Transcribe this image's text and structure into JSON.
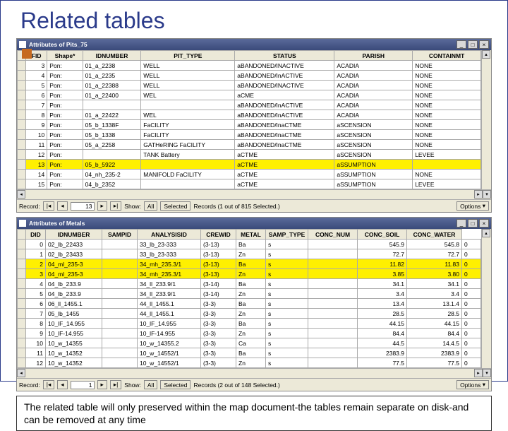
{
  "slide": {
    "title": "Related tables"
  },
  "window1": {
    "title": "Attributes of Pits_75",
    "columns": [
      "FID",
      "Shape*",
      "IDNUMBER",
      "PIT_TYPE",
      "STATUS",
      "PARISH",
      "CONTAINMT"
    ],
    "rows": [
      {
        "sel": false,
        "c": [
          "3",
          "Pon:",
          "01_a_2238",
          "WELL",
          "aBANDONED/INACTIVE",
          "ACADIA",
          "NONE"
        ]
      },
      {
        "sel": false,
        "c": [
          "4",
          "Pon:",
          "01_a_2235",
          "WELL",
          "aBANDONED/InACTIVE",
          "ACADIA",
          "NONE"
        ]
      },
      {
        "sel": false,
        "c": [
          "5",
          "Pon:",
          "01_a_22388",
          "WELL",
          "aBANDONED/INACTIVE",
          "ACADIA",
          "NONE"
        ]
      },
      {
        "sel": false,
        "c": [
          "6",
          "Pon:",
          "01_a_22400",
          "WEL",
          "aCME",
          "ACADIA",
          "NONE"
        ]
      },
      {
        "sel": false,
        "c": [
          "7",
          "Pon:",
          "",
          "",
          "aBANDONED/InACTIVE",
          "ACADIA",
          "NONE"
        ]
      },
      {
        "sel": false,
        "c": [
          "8",
          "Pon:",
          "01_a_22422",
          "WEL",
          "aBANDONED/InACTIVE",
          "ACADIA",
          "NONE"
        ]
      },
      {
        "sel": false,
        "c": [
          "9",
          "Pon:",
          "05_b_1338F",
          "FaCILITY",
          "aBANDONED/InaCTME",
          "aSCENSION",
          "NONE"
        ]
      },
      {
        "sel": false,
        "c": [
          "10",
          "Pon:",
          "05_b_1338",
          "FaCILITY",
          "aBANDONED/InaCTME",
          "aSCENSION",
          "NONE"
        ]
      },
      {
        "sel": false,
        "c": [
          "11",
          "Pon:",
          "05_a_2258",
          "GATHeRING FaCILITY",
          "aBANDONED/InaCTME",
          "aSCENSION",
          "NONE"
        ]
      },
      {
        "sel": false,
        "c": [
          "12",
          "Pon:",
          "",
          "TANK Battery",
          "aCTME",
          "aSCENSION",
          "LEVEE"
        ]
      },
      {
        "sel": true,
        "c": [
          "13",
          "Pon:",
          "05_b_5922",
          "",
          "aCTME",
          "aSSUMPTION",
          ""
        ]
      },
      {
        "sel": false,
        "c": [
          "14",
          "Pon:",
          "04_nh_235-2",
          "MANIFOLD FaCILITY",
          "aCTME",
          "aSSUMPTION",
          "NONE"
        ]
      },
      {
        "sel": false,
        "c": [
          "15",
          "Pon:",
          "04_b_2352",
          "",
          "aCTME",
          "aSSUMPTION",
          "LEVEE"
        ]
      }
    ],
    "status": {
      "record_label": "Record:",
      "record_value": "13",
      "show": "Show:",
      "all": "All",
      "selected": "Selected",
      "recinfo": "Records (1 out of 815 Selected.)",
      "options": "Options"
    }
  },
  "window2": {
    "title": "Attributes of Metals",
    "columns": [
      "DID",
      "IDNUMBER",
      "SAMPID",
      "ANALYSISID",
      "CREWID",
      "METAL",
      "SAMP_TYPE",
      "CONC_NUM",
      "CONC_SOIL",
      "CONC_WATER"
    ],
    "rows": [
      {
        "sel": false,
        "c": [
          "0",
          "02_lb_22433",
          "",
          "33_lb_23-333",
          "(3-13)",
          "Ba",
          "s",
          "",
          "545.9",
          "545.8",
          "0"
        ]
      },
      {
        "sel": false,
        "c": [
          "1",
          "02_lb_23433",
          "",
          "33_lb_23-333",
          "(3-13)",
          "Zn",
          "s",
          "",
          "72.7",
          "72.7",
          "0"
        ]
      },
      {
        "sel": true,
        "c": [
          "2",
          "04_ml_235-3",
          "",
          "34_mh_235.3/1",
          "(3-13)",
          "Ba",
          "s",
          "",
          "11.82",
          "11.83",
          "0"
        ]
      },
      {
        "sel": true,
        "c": [
          "3",
          "04_ml_235-3",
          "",
          "34_mh_235.3/1",
          "(3-13)",
          "Zn",
          "s",
          "",
          "3.85",
          "3.80",
          "0"
        ]
      },
      {
        "sel": false,
        "c": [
          "4",
          "04_lb_233.9",
          "",
          "34_ll_233.9/1",
          "(3-14)",
          "Ba",
          "s",
          "",
          "34.1",
          "34.1",
          "0"
        ]
      },
      {
        "sel": false,
        "c": [
          "5",
          "04_lb_233.9",
          "",
          "34_ll_233.9/1",
          "(3-14)",
          "Zn",
          "s",
          "",
          "3.4",
          "3.4",
          "0"
        ]
      },
      {
        "sel": false,
        "c": [
          "6",
          "06_ll_1455.1",
          "",
          "44_ll_1455.1",
          "(3-3)",
          "Ba",
          "s",
          "",
          "13.4",
          "13.1.4",
          "0"
        ]
      },
      {
        "sel": false,
        "c": [
          "7",
          "05_lb_1455",
          "",
          "44_ll_1455.1",
          "(3-3)",
          "Zn",
          "s",
          "",
          "28.5",
          "28.5",
          "0"
        ]
      },
      {
        "sel": false,
        "c": [
          "8",
          "10_lF_14.955",
          "",
          "10_lF_14.955",
          "(3-3)",
          "Ba",
          "s",
          "",
          "44.15",
          "44.15",
          "0"
        ]
      },
      {
        "sel": false,
        "c": [
          "9",
          "10_lF-14.955",
          "",
          "10_lF-14.955",
          "(3-3)",
          "Zn",
          "s",
          "",
          "84.4",
          "84.4",
          "0"
        ]
      },
      {
        "sel": false,
        "c": [
          "10",
          "10_w_14355",
          "",
          "10_w_14355.2",
          "(3-3)",
          "Ca",
          "s",
          "",
          "44.5",
          "14.4.5",
          "0"
        ]
      },
      {
        "sel": false,
        "c": [
          "11",
          "10_w_14352",
          "",
          "10_w_14552/1",
          "(3-3)",
          "Ba",
          "s",
          "",
          "2383.9",
          "2383.9",
          "0"
        ]
      },
      {
        "sel": false,
        "c": [
          "12",
          "10_w_14352",
          "",
          "10_w_14552/1",
          "(3-3)",
          "Zn",
          "s",
          "",
          "77.5",
          "77.5",
          "0"
        ]
      }
    ],
    "status": {
      "record_label": "Record:",
      "record_value": "1",
      "show": "Show:",
      "all": "All",
      "selected": "Selected",
      "recinfo": "Records (2 out of 148 Selected.)",
      "options": "Options"
    }
  },
  "footer": {
    "text": "The related table will only preserved within the map document-the tables remain separate on disk-and can be removed at any time"
  }
}
